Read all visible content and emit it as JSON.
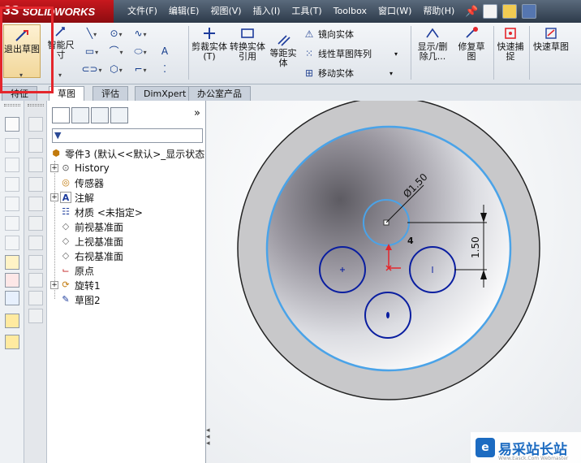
{
  "app": {
    "logo": "SOLIDWORKS",
    "logo_ds": "3S"
  },
  "menu": [
    "文件(F)",
    "编辑(E)",
    "视图(V)",
    "插入(I)",
    "工具(T)",
    "Toolbox",
    "窗口(W)",
    "帮助(H)"
  ],
  "commands": {
    "exit_sketch": "退出草图",
    "smart_dimension": "智能尺寸",
    "trim": "剪裁实体(T)",
    "convert": "转换实体引用",
    "offset": "等距实体",
    "mirror": "镜向实体",
    "linear_pattern": "线性草图阵列",
    "move": "移动实体",
    "show_delete": "显示/删除几...",
    "repair": "修复草图",
    "quick_snap": "快速捕捉",
    "rapid_sketch": "快速草图"
  },
  "tabs": [
    "特征",
    "草图",
    "评估",
    "DimXpert",
    "办公室产品"
  ],
  "tree": {
    "root": "零件3 (默认<<默认>_显示状态",
    "items": [
      "History",
      "传感器",
      "注解",
      "材质 <未指定>",
      "前视基准面",
      "上视基准面",
      "右视基准面",
      "原点",
      "旋转1",
      "草图2"
    ]
  },
  "sketch": {
    "dim_diameter": "Ø1.50",
    "dim_vertical": "1.50",
    "relation": "4"
  },
  "watermark": {
    "text": "易采站长站",
    "sub": "Www.Easck.Com  Webmaster",
    "logo_glyph": "e"
  },
  "colors": {
    "sketch_blue": "#0a1ea0",
    "highlight": "#4aa3e8",
    "accent_red": "#e4262c"
  }
}
